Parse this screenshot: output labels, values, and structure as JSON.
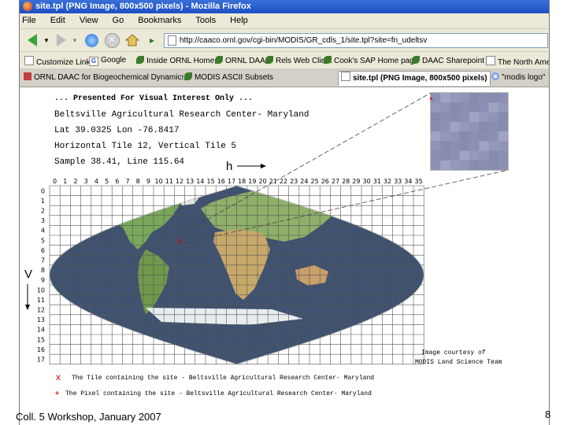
{
  "window": {
    "title": "site.tpl (PNG Image, 800x500 pixels) - Mozilla Firefox"
  },
  "menu": [
    "File",
    "Edit",
    "View",
    "Go",
    "Bookmarks",
    "Tools",
    "Help"
  ],
  "navigation": {
    "url": "http://caaco.ornl.gov/cgi-bin/MODIS/GR_cdls_1/site.tpl?site=fn_udeltsv"
  },
  "bookmarks": [
    {
      "label": "Customize Links",
      "icon": "page-icon"
    },
    {
      "label": "Google",
      "icon": "google-icon"
    },
    {
      "label": "Inside ORNL Home",
      "icon": "leaf-icon"
    },
    {
      "label": "ORNL DAAC",
      "icon": "leaf-icon"
    },
    {
      "label": "Rels Web Client",
      "icon": "leaf-icon"
    },
    {
      "label": "Cook's SAP Home page",
      "icon": "leaf-icon"
    },
    {
      "label": "DAAC Sharepoint",
      "icon": "leaf-icon"
    },
    {
      "label": "The North America",
      "icon": "page-icon"
    }
  ],
  "tabs": [
    {
      "label": "ORNL DAAC for Biogeochemical Dynamics",
      "active": false
    },
    {
      "label": "MODIS ASCII Subsets",
      "active": false
    },
    {
      "label": "site.tpl (PNG Image, 800x500 pixels)",
      "active": true
    },
    {
      "label": "\"modis logo\"",
      "active": false
    }
  ],
  "info": {
    "line1": "... Presented For Visual Interest Only ...",
    "line2": "Beltsville Agricultural Research Center- Maryland",
    "line3": "Lat 39.0325  Lon -76.8417",
    "line4": "Horizontal Tile 12, Vertical Tile 5",
    "line5": "Sample 38.41, Line 115.64"
  },
  "grid": {
    "h_label": "h",
    "v_label": "V",
    "h_ticks": [
      "0",
      "1",
      "2",
      "3",
      "4",
      "5",
      "6",
      "7",
      "8",
      "9",
      "10",
      "11",
      "12",
      "13",
      "14",
      "15",
      "16",
      "17",
      "18",
      "19",
      "20",
      "21",
      "22",
      "23",
      "24",
      "25",
      "26",
      "27",
      "28",
      "29",
      "30",
      "31",
      "32",
      "33",
      "34",
      "35"
    ],
    "v_ticks": [
      "0",
      "1",
      "2",
      "3",
      "4",
      "5",
      "6",
      "7",
      "8",
      "9",
      "10",
      "11",
      "12",
      "13",
      "14",
      "15",
      "16",
      "17"
    ],
    "site_tile": {
      "h": 12,
      "v": 5
    }
  },
  "credit": {
    "line1": "Image courtesy of",
    "line2": "MODIS Land Science Team"
  },
  "legend": {
    "tile_text": "The Tile containing the site - Beltsville Agricultural Research Center- Maryland",
    "pixel_text": "The Pixel containing the site - Beltsville Agricultural Research Center- Maryland"
  },
  "slide": {
    "footer": "Coll. 5 Workshop, January 2007",
    "page_number": "8"
  },
  "colors": {
    "titlebar": "#2a5fcf",
    "ocean": "#3f5270",
    "land": "#7aa85a",
    "marker": "#e00000"
  }
}
